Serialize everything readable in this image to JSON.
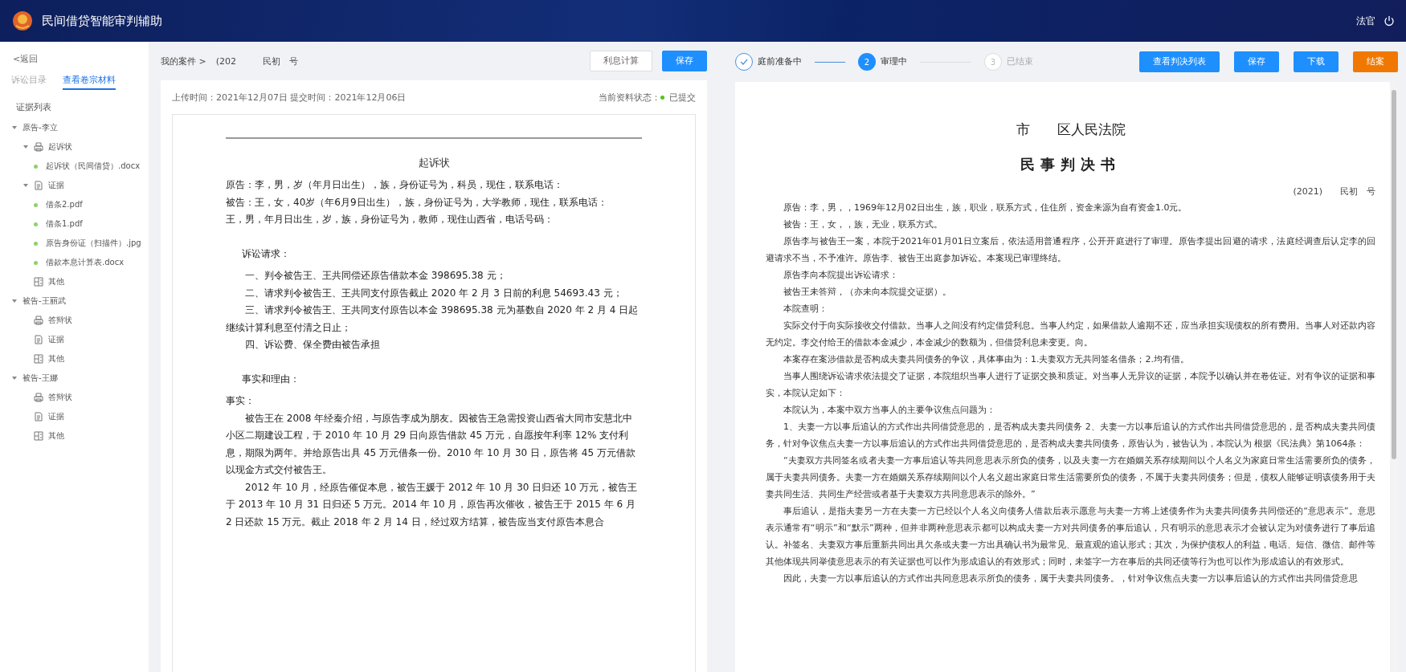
{
  "header": {
    "title": "民间借贷智能审判辅助",
    "user": "法官"
  },
  "sidebar": {
    "back": "<返回",
    "tabs": [
      {
        "label": "诉讼目录",
        "selected": false
      },
      {
        "label": "查看卷宗材料",
        "selected": true
      }
    ],
    "section": "证据列表",
    "tree": [
      {
        "label": "原告-李立",
        "children": [
          {
            "label": "起诉状",
            "kind": "complaint",
            "children": [
              {
                "label": "起诉状（民间借贷）.docx",
                "kind": "file"
              }
            ]
          },
          {
            "label": "证据",
            "kind": "evidence",
            "children": [
              {
                "label": "借条2.pdf",
                "kind": "file"
              },
              {
                "label": "借条1.pdf",
                "kind": "file"
              },
              {
                "label": "原告身份证（扫描件）.jpg",
                "kind": "file"
              },
              {
                "label": "借款本息计算表.docx",
                "kind": "file"
              }
            ]
          },
          {
            "label": "其他",
            "kind": "other"
          }
        ]
      },
      {
        "label": "被告-王丽武",
        "children": [
          {
            "label": "答辩状",
            "kind": "complaint"
          },
          {
            "label": "证据",
            "kind": "evidence"
          },
          {
            "label": "其他",
            "kind": "other"
          }
        ]
      },
      {
        "label": "被告-王娜",
        "children": [
          {
            "label": "答辩状",
            "kind": "complaint"
          },
          {
            "label": "证据",
            "kind": "evidence"
          },
          {
            "label": "其他",
            "kind": "other"
          }
        ]
      }
    ]
  },
  "case_panel": {
    "breadcrumb": {
      "root": "我的案件 >",
      "case": "(202　　　民初　号"
    },
    "buttons": [
      {
        "label": "利息计算",
        "kind": "outline"
      },
      {
        "label": "保存",
        "kind": "primary"
      }
    ],
    "upload_info": "上传时间：2021年12月07日 提交时间：2021年12月06日",
    "status_label": "当前资料状态：",
    "status": {
      "label": "已提交",
      "color": "#52c41a"
    },
    "document": {
      "title": "起诉状",
      "blocks": [
        {
          "kind": "party",
          "text": "原告：李，男，岁（年月日出生），族，身份证号为，科员，现住，联系电话："
        },
        {
          "kind": "party",
          "text": "被告：王，女，40岁（年6月9日出生），族，身份证号为，大学教师，现住，联系电话："
        },
        {
          "kind": "party",
          "text": "王，男，年月日出生，岁，族，身份证号为，教师，现住山西省，电话号码："
        },
        {
          "kind": "section",
          "text": "诉讼请求："
        },
        {
          "kind": "indent",
          "text": "一、判令被告王、王共同偿还原告借款本金 398695.38 元；"
        },
        {
          "kind": "indent",
          "text": "二、请求判令被告王、王共同支付原告截止 2020 年 2 月 3 日前的利息 54693.43 元；"
        },
        {
          "kind": "indent",
          "text": "三、请求判令被告王、王共同支付原告以本金 398695.38 元为基数自 2020 年 2 月 4 日起继续计算利息至付清之日止；"
        },
        {
          "kind": "indent",
          "text": "四、诉讼费、保全费由被告承担"
        },
        {
          "kind": "section",
          "text": "事实和理由："
        },
        {
          "kind": "label",
          "text": "事实："
        },
        {
          "kind": "indent",
          "text": "被告王在 2008 年经秦介绍，与原告李成为朋友。因被告王急需投资山西省大同市安慧北中小区二期建设工程，于 2010 年 10 月 29 日向原告借款 45 万元，自愿按年利率 12% 支付利息，期限为两年。并给原告出具 45 万元借条一份。2010 年 10 月 30 日，原告将 45 万元借款以现金方式交付被告王。"
        },
        {
          "kind": "indent",
          "text": "2012 年 10 月，经原告催促本息，被告王媛于 2012 年 10 月 30 日归还 10 万元，被告王于 2013 年 10 月 31 日归还 5 万元。2014 年 10 月，原告再次催收，被告王于 2015 年 6 月 2 日还款 15 万元。截止 2018 年 2 月 14 日，经过双方结算，被告应当支付原告本息合"
        }
      ]
    }
  },
  "judgment_panel": {
    "steps": [
      {
        "label": "庭前准备中",
        "completed": true,
        "selected": false
      },
      {
        "label": "审理中",
        "marker": "2",
        "completed": false,
        "selected": true
      },
      {
        "label": "已结束",
        "marker": "3",
        "completed": false,
        "selected": false
      }
    ],
    "buttons": [
      {
        "label": "查看判决列表",
        "kind": "primary"
      },
      {
        "label": "保存",
        "kind": "primary"
      },
      {
        "label": "下载",
        "kind": "primary"
      },
      {
        "label": "结案",
        "kind": "warning"
      }
    ],
    "document": {
      "court": "市　　区人民法院",
      "title": "民事判决书",
      "case_no": "(2021)　　民初　号",
      "paragraphs": [
        "原告：李，男，，1969年12月02日出生，族，职业，联系方式，住住所，资金来源为自有资金1.0元。",
        "被告：王，女，，族，无业，联系方式。",
        "原告李与被告王一案，本院于2021年01月01日立案后，依法适用普通程序，公开开庭进行了审理。原告李提出回避的请求，法庭经调查后认定李的回避请求不当，不予准许。原告李、被告王出庭参加诉讼。本案现已审理终结。",
        "原告李向本院提出诉讼请求：",
        "被告王未答辩，（亦未向本院提交证据）。",
        "本院查明：",
        "实际交付于向实际接收交付借款。当事人之间没有约定借贷利息。当事人约定，如果借款人逾期不还，应当承担实现债权的所有费用。当事人对还款内容无约定。李交付给王的借款本金减少，本金减少的数额为，但借贷利息未变更。向。",
        "本案存在案涉借款是否构成夫妻共同债务的争议，具体事由为：1.夫妻双方无共同签名借条；2.均有借。",
        "当事人围绕诉讼请求依法提交了证据，本院组织当事人进行了证据交换和质证。对当事人无异议的证据，本院予以确认并在卷佐证。对有争议的证据和事实，本院认定如下：",
        "本院认为，本案中双方当事人的主要争议焦点问题为：",
        "1、夫妻一方以事后追认的方式作出共同借贷意思的，是否构成夫妻共同债务 2、夫妻一方以事后追认的方式作出共同借贷意思的，是否构成夫妻共同债务，针对争议焦点夫妻一方以事后追认的方式作出共同借贷意思的，是否构成夫妻共同债务，原告认为，被告认为，本院认为 根据《民法典》第1064条：",
        "“夫妻双方共同签名或者夫妻一方事后追认等共同意思表示所负的债务，以及夫妻一方在婚姻关系存续期间以个人名义为家庭日常生活需要所负的债务，属于夫妻共同债务。夫妻一方在婚姻关系存续期间以个人名义超出家庭日常生活需要所负的债务，不属于夫妻共同债务；但是，债权人能够证明该债务用于夫妻共同生活、共同生产经营或者基于夫妻双方共同意思表示的除外。”",
        "事后追认，是指夫妻另一方在夫妻一方已经以个人名义向债务人借款后表示愿意与夫妻一方将上述债务作为夫妻共同债务共同偿还的“意思表示”。意思表示通常有“明示”和“默示”两种，但并非两种意思表示都可以构成夫妻一方对共同债务的事后追认，只有明示的意思表示才会被认定为对债务进行了事后追认。补签名、夫妻双方事后重新共同出具欠条或夫妻一方出具确认书为最常见、最直观的追认形式；其次，为保护债权人的利益，电话、短信、微信、邮件等其他体现共同举债意思表示的有关证据也可以作为形成追认的有效形式；同时，未签字一方在事后的共同还债等行为也可以作为形成追认的有效形式。",
        "因此，夫妻一方以事后追认的方式作出共同意思表示所负的债务，属于夫妻共同债务。，针对争议焦点夫妻一方以事后追认的方式作出共同借贷意思"
      ]
    }
  }
}
